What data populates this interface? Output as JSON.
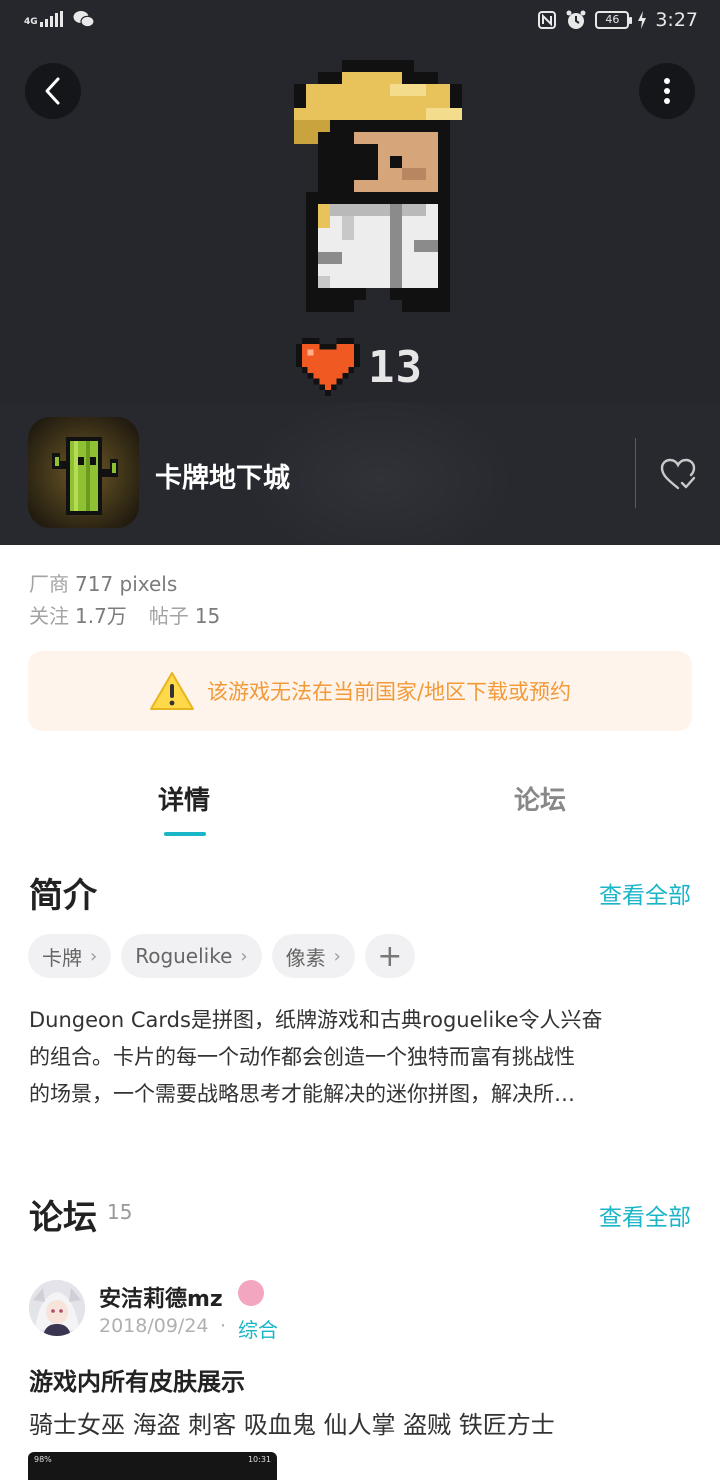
{
  "status_bar": {
    "network": "4G",
    "battery": "46",
    "time": "3:27"
  },
  "hero": {
    "likes": "13",
    "accent_color": "#f05a22"
  },
  "app": {
    "title": "卡牌地下城"
  },
  "meta": {
    "vendor_label": "厂商",
    "vendor_value": "717 pixels",
    "follow_label": "关注",
    "follow_value": "1.7万",
    "posts_label": "帖子",
    "posts_value": "15"
  },
  "notice": {
    "text": "该游戏无法在当前国家/地区下载或预约",
    "color": "#f29a38"
  },
  "tabs": {
    "detail": "详情",
    "forum": "论坛",
    "active_color": "#1bb5c8"
  },
  "intro": {
    "title": "简介",
    "see_all": "查看全部",
    "tags": [
      "卡牌",
      "Roguelike",
      "像素"
    ],
    "add_tag": "+",
    "description_lines": [
      "Dungeon Cards是拼图，纸牌游戏和古典roguelike令人兴奋",
      "的组合。卡片的每一个动作都会创造一个独特而富有挑战性",
      "的场景，一个需要战略思考才能解决的迷你拼图，解决所…"
    ]
  },
  "forum": {
    "title": "论坛",
    "count": "15",
    "see_all": "查看全部",
    "post": {
      "user": "安洁莉德mz",
      "date": "2018/09/24",
      "dot": "·",
      "category": "综合",
      "title": "游戏内所有皮肤展示",
      "body": "骑士女巫 海盗  刺客 吸血鬼 仙人掌 盗贼 铁匠方士",
      "thumb_time": "10:31",
      "thumb_battery": "98%"
    }
  }
}
